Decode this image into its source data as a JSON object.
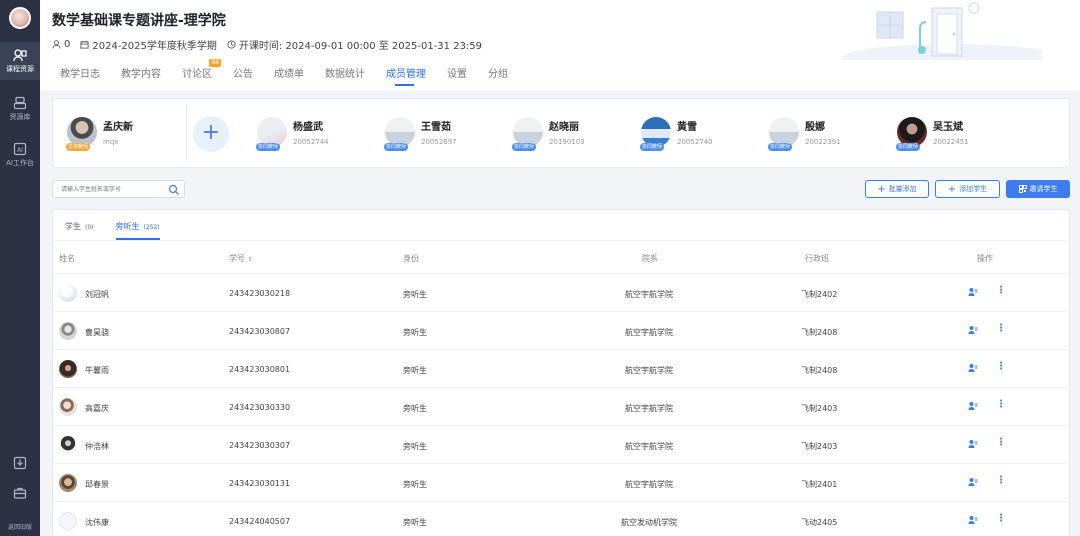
{
  "sidebar": {
    "items": [
      {
        "label": "课程资源",
        "icon": "course-icon"
      },
      {
        "label": "资源库",
        "icon": "library-icon"
      },
      {
        "label": "AI工作台",
        "icon": "ai-icon"
      }
    ],
    "bottom_label": "返回旧版"
  },
  "header": {
    "title": "数学基础课专题讲座-理学院",
    "people_count": "0",
    "semester": "2024-2025学年度秋季学期",
    "schedule": "开课时间: 2024-09-01 00:00 至 2025-01-31 23:59",
    "tabs": [
      {
        "label": "教学日志"
      },
      {
        "label": "教学内容"
      },
      {
        "label": "讨论区",
        "badge": "88"
      },
      {
        "label": "公告"
      },
      {
        "label": "成绩单"
      },
      {
        "label": "数据统计"
      },
      {
        "label": "成员管理",
        "active": true
      },
      {
        "label": "设置"
      },
      {
        "label": "分组"
      }
    ]
  },
  "teachers": [
    {
      "name": "孟庆新",
      "id": "mqx",
      "badge": "主讲教师",
      "main": true
    },
    {
      "name": "杨盛武",
      "id": "20052744",
      "badge": "协同教师"
    },
    {
      "name": "王雪茹",
      "id": "20052697",
      "badge": "协同教师"
    },
    {
      "name": "赵晓丽",
      "id": "20190103",
      "badge": "协同教师"
    },
    {
      "name": "黄雪",
      "id": "20052740",
      "badge": "协同教师"
    },
    {
      "name": "殷娜",
      "id": "20022391",
      "badge": "协同教师"
    },
    {
      "name": "吴玉斌",
      "id": "20022451",
      "badge": "协同教师"
    }
  ],
  "search": {
    "placeholder": "请输入学生姓名或学号"
  },
  "actions": {
    "batch_add": "批量添加",
    "add_student": "添加学生",
    "invite": "邀请学生"
  },
  "member_tabs": [
    {
      "label": "学生",
      "count": "(0)"
    },
    {
      "label": "旁听生",
      "count": "(252)",
      "active": true
    }
  ],
  "table": {
    "headers": {
      "name": "姓名",
      "student_id": "学号",
      "identity": "身份",
      "department": "院系",
      "class": "行政班",
      "actions": "操作"
    },
    "rows": [
      {
        "name": "刘冠帆",
        "student_id": "243423030218",
        "identity": "旁听生",
        "department": "航空宇航学院",
        "class": "飞制2402"
      },
      {
        "name": "曹昊骁",
        "student_id": "243423030807",
        "identity": "旁听生",
        "department": "航空宇航学院",
        "class": "飞制2408"
      },
      {
        "name": "牛馨雨",
        "student_id": "243423030801",
        "identity": "旁听生",
        "department": "航空宇航学院",
        "class": "飞制2408"
      },
      {
        "name": "高嘉庆",
        "student_id": "243423030330",
        "identity": "旁听生",
        "department": "航空宇航学院",
        "class": "飞制2403"
      },
      {
        "name": "仲浩林",
        "student_id": "243423030307",
        "identity": "旁听生",
        "department": "航空宇航学院",
        "class": "飞制2403"
      },
      {
        "name": "邱春景",
        "student_id": "243423030131",
        "identity": "旁听生",
        "department": "航空宇航学院",
        "class": "飞制2401"
      },
      {
        "name": "沈伟康",
        "student_id": "243424040507",
        "identity": "旁听生",
        "department": "航空发动机学院",
        "class": "飞动2405"
      }
    ]
  },
  "colors": {
    "accent": "#2f6ef0",
    "sidebar_bg": "#2c3244",
    "badge_main": "#f3a83b",
    "badge_co": "#4a8cf0"
  }
}
